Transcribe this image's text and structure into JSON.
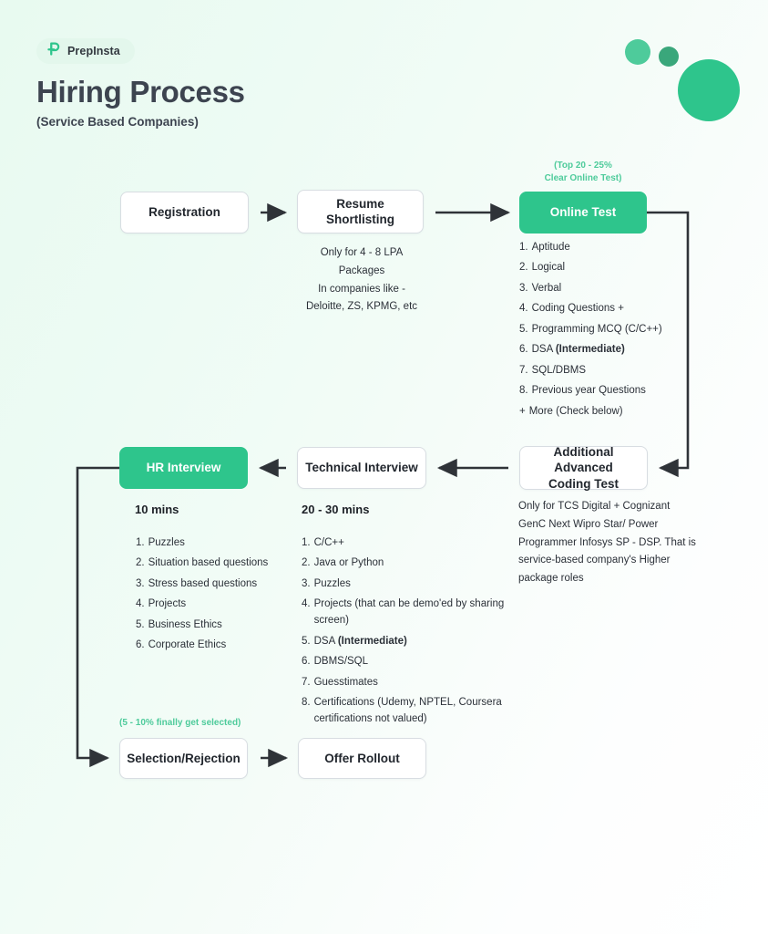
{
  "brand": {
    "logo_name": "prepinsta-logo",
    "logo_text": "PrepInsta",
    "badge_bg": "#E3F7EC",
    "accent": "#2EC58C"
  },
  "header": {
    "title": "Hiring Process",
    "subtitle": "(Service Based Companies)"
  },
  "theme": {
    "accent_green": "#2EC58C",
    "note_green": "#4ECB9B",
    "circle_light": "#4ECB9B",
    "circle_dark": "#3AA77B",
    "text_dark": "#2B3038",
    "background_start": "#E8FAF0",
    "background_end": "#FFFFFF",
    "connector": "#2F3338"
  },
  "nodes": {
    "registration": "Registration",
    "resume_shortlisting": "Resume\nShortlisting",
    "online_test": "Online Test",
    "hr_interview": "HR Interview",
    "technical_interview": "Technical Interview",
    "advanced_coding_test": "Additional Advanced\nCoding Test",
    "selection_rejection": "Selection/Rejection",
    "offer_rollout": "Offer Rollout"
  },
  "notes": {
    "online_test_top": "(Top 20 - 25%\nClear Online Test)",
    "resume_shortlisting": "Only for 4 - 8 LPA\nPackages\nIn companies like -\nDeloitte, ZS, KPMG, etc",
    "advanced_coding": "Only for TCS Digital + Cognizant GenC Next Wipro Star/ Power Programmer Infosys SP - DSP. That is service-based company's Higher package roles",
    "selection_rate": "(5 - 10% finally get selected)",
    "hr_duration": "10 mins",
    "technical_duration": "20 - 30 mins"
  },
  "lists": {
    "online_test": [
      {
        "num": "1.",
        "text": "Aptitude"
      },
      {
        "num": "2.",
        "text": "Logical"
      },
      {
        "num": "3.",
        "text": "Verbal"
      },
      {
        "num": "4.",
        "text": "Coding Questions +"
      },
      {
        "num": "5.",
        "text": "Programming MCQ (C/C++)"
      },
      {
        "num": "6.",
        "text": "DSA ",
        "bold": "(Intermediate)"
      },
      {
        "num": "7.",
        "text": "SQL/DBMS"
      },
      {
        "num": "8.",
        "text": "Previous year Questions"
      },
      {
        "num": "+",
        "text": "More (Check below)"
      }
    ],
    "hr_interview": [
      {
        "num": "1.",
        "text": "Puzzles"
      },
      {
        "num": "2.",
        "text": "Situation based questions"
      },
      {
        "num": "3.",
        "text": "Stress based questions"
      },
      {
        "num": "4.",
        "text": "Projects"
      },
      {
        "num": "5.",
        "text": "Business Ethics"
      },
      {
        "num": "6.",
        "text": "Corporate Ethics"
      }
    ],
    "technical_interview": [
      {
        "num": "1.",
        "text": "C/C++"
      },
      {
        "num": "2.",
        "text": "Java or Python"
      },
      {
        "num": "3.",
        "text": "Puzzles"
      },
      {
        "num": "4.",
        "text": "Projects (that can be demo'ed by sharing screen)"
      },
      {
        "num": "5.",
        "text": "DSA ",
        "bold": "(Intermediate)"
      },
      {
        "num": "6.",
        "text": "DBMS/SQL"
      },
      {
        "num": "7.",
        "text": "Guesstimates"
      },
      {
        "num": "8.",
        "text": "Certifications (Udemy, NPTEL, Coursera certifications not valued)"
      }
    ]
  }
}
